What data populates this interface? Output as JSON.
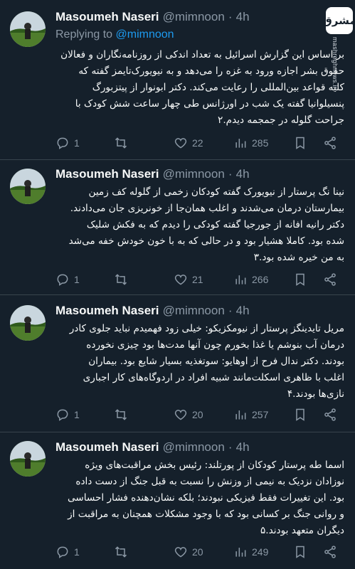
{
  "watermark": {
    "logo_text": "مشرق",
    "url": "mashreghnews.ir"
  },
  "tweets": [
    {
      "name": "Masoumeh Naseri",
      "handle": "@mimnoon",
      "dot": "·",
      "time": "4h",
      "reply_prefix": "Replying to",
      "reply_mention": "@mimnoon",
      "lines": [
        "بر اساس این گزارش اسرائیل به تعداد اندکی از روزنامه‌نگاران و فعالان",
        "حقوق بشر اجازه ورود به غزه را می‌دهد و به نیویورک‌تایمز گفته که",
        "کلیه قواعد بین‌المللی را رعایت می‌کند. دکتر ابونوار از پیتزبورگ",
        "پنسیلوانیا گفته یک شب در اورژانس طی چهار ساعت شش کودک با",
        "جراحت گلوله در جمجمه دیدم.۲"
      ],
      "replies": "1",
      "retweets": "",
      "likes": "22",
      "views": "285"
    },
    {
      "name": "Masoumeh Naseri",
      "handle": "@mimnoon",
      "dot": "·",
      "time": "4h",
      "reply_prefix": "",
      "reply_mention": "",
      "lines": [
        "نینا نگ پرستار از نیویورک گفته کودکان زخمی از گلوله کف زمین",
        "بیمارستان درمان می‌شدند و اغلب همان‌جا از خونریزی جان می‌دادند.",
        "دکتر رانیه افانه از جورجیا گفته کودکی را دیدم که به فکش شلیک",
        "شده بود. کاملا هشیار بود و در حالی که به با خون خودش خفه می‌شد",
        "به من خیره شده بود.۳"
      ],
      "replies": "1",
      "retweets": "",
      "likes": "21",
      "views": "266"
    },
    {
      "name": "Masoumeh Naseri",
      "handle": "@mimnoon",
      "dot": "·",
      "time": "4h",
      "reply_prefix": "",
      "reply_mention": "",
      "lines": [
        "مریل تایدینگز پرستار از نیومکزیکو: خیلی زود فهمیدم نباید جلوی کادر",
        "درمان آب بنوشم یا غذا بخورم چون آنها مدت‌ها بود چیزی نخورده",
        "بودند. دکتر ندال فرح از اوهایو: سوتغذیه بسیار شایع بود. بیماران",
        "اغلب با ظاهری اسکلت‌مانند شبیه افراد در اردوگاه‌های کار اجباری",
        "نازی‌ها بودند.۴"
      ],
      "replies": "1",
      "retweets": "",
      "likes": "20",
      "views": "257"
    },
    {
      "name": "Masoumeh Naseri",
      "handle": "@mimnoon",
      "dot": "·",
      "time": "4h",
      "reply_prefix": "",
      "reply_mention": "",
      "lines": [
        "اسما طه پرستار کودکان از پورتلند: رئیس بخش مراقبت‌های ویژه",
        "نوزادان نزدیک به نیمی از وزنش را نسبت به قبل جنگ از دست داده",
        "بود. این تغییرات فقط فیزیکی نبودند؛ بلکه نشان‌دهنده فشار احساسی",
        "و روانی جنگ بر کسانی بود که با وجود مشکلات همچنان به مراقبت از",
        "دیگران متعهد بودند.۵"
      ],
      "replies": "1",
      "retweets": "",
      "likes": "20",
      "views": "249"
    }
  ]
}
